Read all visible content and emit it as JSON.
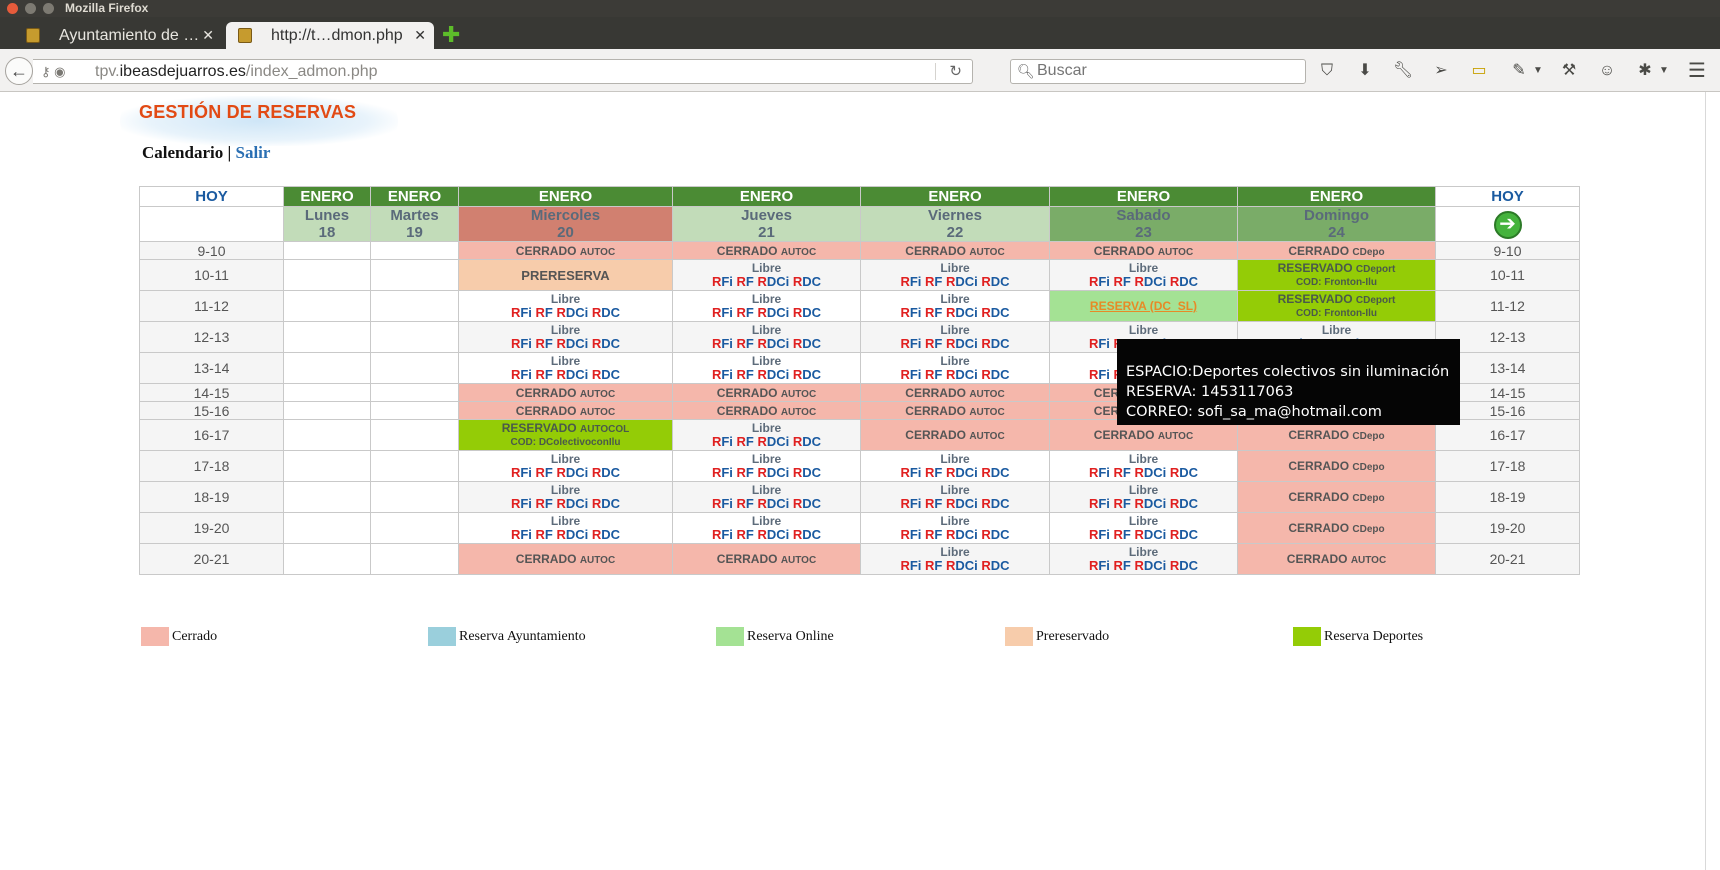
{
  "window": {
    "title": "Mozilla Firefox"
  },
  "tabs": [
    {
      "label": "Ayuntamiento de …",
      "active": false
    },
    {
      "label": "http://t…dmon.php",
      "active": true
    }
  ],
  "nav": {
    "url_prefix": "tpv.",
    "url_host": "ibeasdejuarros.es",
    "url_path": "/index_admon.php",
    "search_placeholder": "Buscar"
  },
  "toolbar_icons": [
    "pocket-icon",
    "download-icon",
    "wrench-icon",
    "send-icon",
    "ruler-icon",
    "eyedropper-icon",
    "hammer-icon",
    "chat-icon",
    "extensions-icon",
    "menu-icon"
  ],
  "page": {
    "title": "GESTIÓN DE RESERVAS",
    "nav_calendario": "Calendario",
    "nav_sep": "|",
    "nav_salir": "Salir"
  },
  "calendar": {
    "hoy_label": "HOY",
    "link_labels": {
      "r": "R",
      "fi": "Fi",
      "f": "F",
      "dci": "DCi",
      "dc": "DC"
    },
    "libre_label": "Libre",
    "days": [
      {
        "month": "ENERO",
        "name": "Lunes",
        "num": "18",
        "style": "pastlight"
      },
      {
        "month": "ENERO",
        "name": "Martes",
        "num": "19",
        "style": "pastlight"
      },
      {
        "month": "ENERO",
        "name": "Miercoles",
        "num": "20",
        "style": "today"
      },
      {
        "month": "ENERO",
        "name": "Jueves",
        "num": "21",
        "style": "future"
      },
      {
        "month": "ENERO",
        "name": "Viernes",
        "num": "22",
        "style": "future"
      },
      {
        "month": "ENERO",
        "name": "Sabado",
        "num": "23",
        "style": "weekend"
      },
      {
        "month": "ENERO",
        "name": "Domingo",
        "num": "24",
        "style": "weekend"
      }
    ],
    "rows": [
      {
        "hour": "9-10",
        "h": 18,
        "cells": [
          {
            "t": "blank"
          },
          {
            "t": "blank"
          },
          {
            "t": "cerrado",
            "code": "AUTOC"
          },
          {
            "t": "cerrado",
            "code": "AUTOC"
          },
          {
            "t": "cerrado",
            "code": "AUTOC"
          },
          {
            "t": "cerrado",
            "code": "AUTOC"
          },
          {
            "t": "cerrado",
            "code": "CDepo"
          }
        ]
      },
      {
        "hour": "10-11",
        "h": 31,
        "cells": [
          {
            "t": "blank"
          },
          {
            "t": "blank"
          },
          {
            "t": "prereserva",
            "text": "PRERESERVA"
          },
          {
            "t": "libre"
          },
          {
            "t": "libre"
          },
          {
            "t": "libre"
          },
          {
            "t": "reservado",
            "code": "CDeport",
            "cod": "COD: Fronton-Ilu"
          }
        ]
      },
      {
        "hour": "11-12",
        "h": 31,
        "cells": [
          {
            "t": "blank"
          },
          {
            "t": "blank"
          },
          {
            "t": "libre"
          },
          {
            "t": "libre"
          },
          {
            "t": "libre"
          },
          {
            "t": "online",
            "text": "RESERVA (DC_SL)"
          },
          {
            "t": "reservado",
            "code": "CDeport",
            "cod": "COD: Fronton-Ilu"
          }
        ]
      },
      {
        "hour": "12-13",
        "h": 31,
        "cells": [
          {
            "t": "blank"
          },
          {
            "t": "blank"
          },
          {
            "t": "libre"
          },
          {
            "t": "libre"
          },
          {
            "t": "libre"
          },
          {
            "t": "libre"
          },
          {
            "t": "libre"
          }
        ]
      },
      {
        "hour": "13-14",
        "h": 31,
        "cells": [
          {
            "t": "blank"
          },
          {
            "t": "blank"
          },
          {
            "t": "libre"
          },
          {
            "t": "libre"
          },
          {
            "t": "libre"
          },
          {
            "t": "libre"
          },
          {
            "t": "libre"
          }
        ]
      },
      {
        "hour": "14-15",
        "h": 18,
        "cells": [
          {
            "t": "blank"
          },
          {
            "t": "blank"
          },
          {
            "t": "cerrado",
            "code": "AUTOC"
          },
          {
            "t": "cerrado",
            "code": "AUTOC"
          },
          {
            "t": "cerrado",
            "code": "AUTOC"
          },
          {
            "t": "cerrado",
            "code": "AUTOC"
          },
          {
            "t": "cerrado",
            "code": "CDepo"
          }
        ]
      },
      {
        "hour": "15-16",
        "h": 18,
        "cells": [
          {
            "t": "blank"
          },
          {
            "t": "blank"
          },
          {
            "t": "cerrado",
            "code": "AUTOC"
          },
          {
            "t": "cerrado",
            "code": "AUTOC"
          },
          {
            "t": "cerrado",
            "code": "AUTOC"
          },
          {
            "t": "cerrado",
            "code": "AUTOC"
          },
          {
            "t": "cerrado",
            "code": "CDepo"
          }
        ]
      },
      {
        "hour": "16-17",
        "h": 31,
        "cells": [
          {
            "t": "blank"
          },
          {
            "t": "blank"
          },
          {
            "t": "reservado",
            "code": "AUTOCOL",
            "cod": "COD: DColectivoconIlu"
          },
          {
            "t": "libre"
          },
          {
            "t": "cerrado",
            "code": "AUTOC"
          },
          {
            "t": "cerrado",
            "code": "AUTOC"
          },
          {
            "t": "cerrado",
            "code": "CDepo"
          }
        ]
      },
      {
        "hour": "17-18",
        "h": 31,
        "cells": [
          {
            "t": "blank"
          },
          {
            "t": "blank"
          },
          {
            "t": "libre"
          },
          {
            "t": "libre"
          },
          {
            "t": "libre"
          },
          {
            "t": "libre"
          },
          {
            "t": "cerrado",
            "code": "CDepo"
          }
        ]
      },
      {
        "hour": "18-19",
        "h": 31,
        "cells": [
          {
            "t": "blank"
          },
          {
            "t": "blank"
          },
          {
            "t": "libre"
          },
          {
            "t": "libre"
          },
          {
            "t": "libre"
          },
          {
            "t": "libre"
          },
          {
            "t": "cerrado",
            "code": "CDepo"
          }
        ]
      },
      {
        "hour": "19-20",
        "h": 31,
        "cells": [
          {
            "t": "blank"
          },
          {
            "t": "blank"
          },
          {
            "t": "libre"
          },
          {
            "t": "libre"
          },
          {
            "t": "libre"
          },
          {
            "t": "libre"
          },
          {
            "t": "cerrado",
            "code": "CDepo"
          }
        ]
      },
      {
        "hour": "20-21",
        "h": 31,
        "cells": [
          {
            "t": "blank"
          },
          {
            "t": "blank"
          },
          {
            "t": "cerrado",
            "code": "AUTOC"
          },
          {
            "t": "cerrado",
            "code": "AUTOC"
          },
          {
            "t": "libre"
          },
          {
            "t": "libre"
          },
          {
            "t": "cerrado",
            "code": "AUTOC"
          }
        ]
      }
    ],
    "cerrado_label": "CERRADO",
    "reservado_label": "RESERVADO"
  },
  "legend": [
    {
      "label": "Cerrado",
      "color": "#f5b7ab"
    },
    {
      "label": "Reserva Ayuntamiento",
      "color": "#9acfdc"
    },
    {
      "label": "Reserva Online",
      "color": "#a4e294"
    },
    {
      "label": "Prereservado",
      "color": "#f7ccab"
    },
    {
      "label": "Reserva Deportes",
      "color": "#94cc06"
    }
  ],
  "tooltip": {
    "espacio": "ESPACIO:Deportes colectivos sin iluminación",
    "reserva": "RESERVA: 1453117063",
    "correo": "CORREO: sofi_sa_ma@hotmail.com"
  }
}
